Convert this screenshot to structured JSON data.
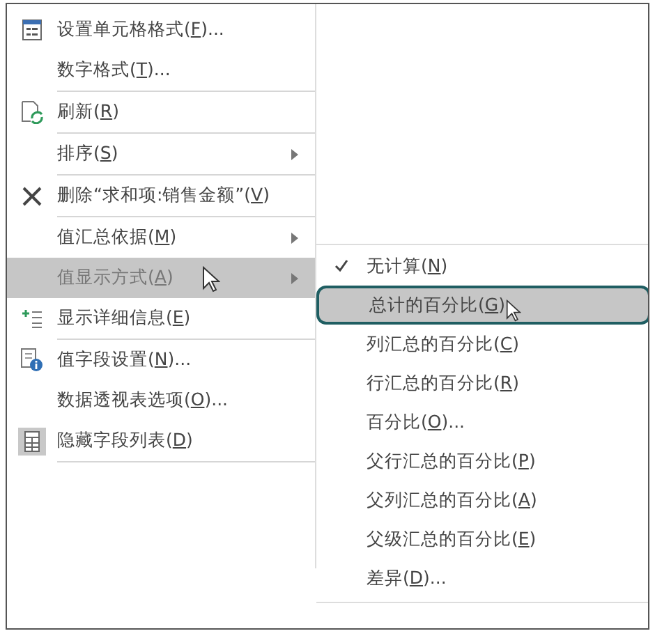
{
  "context_menu": {
    "items": [
      {
        "kind": "format",
        "text": "设置单元格格式(",
        "key": "F",
        "tail": ")...",
        "has_submenu": false,
        "hovered": false,
        "separator_after": false
      },
      {
        "kind": "plain",
        "text": "数字格式(",
        "key": "T",
        "tail": ")...",
        "has_submenu": false,
        "hovered": false,
        "separator_after": true
      },
      {
        "kind": "refresh",
        "text": "刷新(",
        "key": "R",
        "tail": ")",
        "has_submenu": false,
        "hovered": false,
        "separator_after": true
      },
      {
        "kind": "plain",
        "text": "排序(",
        "key": "S",
        "tail": ")",
        "has_submenu": true,
        "hovered": false,
        "separator_after": true
      },
      {
        "kind": "delete",
        "text": "删除“求和项:销售金额”(",
        "key": "V",
        "tail": ")",
        "has_submenu": false,
        "hovered": false,
        "separator_after": true
      },
      {
        "kind": "plain",
        "text": "值汇总依据(",
        "key": "M",
        "tail": ")",
        "has_submenu": true,
        "hovered": false,
        "separator_after": false
      },
      {
        "kind": "plain",
        "text": "值显示方式(",
        "key": "A",
        "tail": ")",
        "has_submenu": true,
        "hovered": true,
        "separator_after": false
      },
      {
        "kind": "details",
        "text": "显示详细信息(",
        "key": "E",
        "tail": ")",
        "has_submenu": false,
        "hovered": false,
        "separator_after": true
      },
      {
        "kind": "field_settings",
        "text": "值字段设置(",
        "key": "N",
        "tail": ")...",
        "has_submenu": false,
        "hovered": false,
        "separator_after": false
      },
      {
        "kind": "plain",
        "text": "数据透视表选项(",
        "key": "O",
        "tail": ")...",
        "has_submenu": false,
        "hovered": false,
        "separator_after": false
      },
      {
        "kind": "field_list",
        "text": "隐藏字段列表(",
        "key": "D",
        "tail": ")",
        "has_submenu": false,
        "hovered": false,
        "separator_after": true
      }
    ]
  },
  "submenu": {
    "items": [
      {
        "text": "无计算(",
        "key": "N",
        "tail": ")",
        "checked": true,
        "hovered": false
      },
      {
        "text": "总计的百分比(",
        "key": "G",
        "tail": ")",
        "checked": false,
        "hovered": true
      },
      {
        "text": "列汇总的百分比(",
        "key": "C",
        "tail": ")",
        "checked": false,
        "hovered": false
      },
      {
        "text": "行汇总的百分比(",
        "key": "R",
        "tail": ")",
        "checked": false,
        "hovered": false
      },
      {
        "text": "百分比(",
        "key": "O",
        "tail": ")...",
        "checked": false,
        "hovered": false
      },
      {
        "text": "父行汇总的百分比(",
        "key": "P",
        "tail": ")",
        "checked": false,
        "hovered": false
      },
      {
        "text": "父列汇总的百分比(",
        "key": "A",
        "tail": ")",
        "checked": false,
        "hovered": false
      },
      {
        "text": "父级汇总的百分比(",
        "key": "E",
        "tail": ")",
        "checked": false,
        "hovered": false
      },
      {
        "text": "差异(",
        "key": "D",
        "tail": ")...",
        "checked": false,
        "hovered": false
      }
    ]
  }
}
